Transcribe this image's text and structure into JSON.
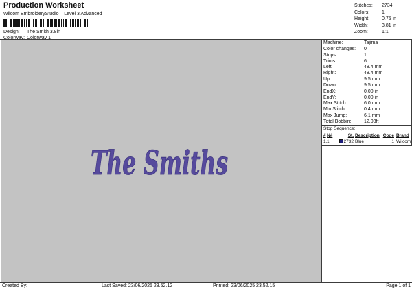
{
  "header": {
    "title": "Production Worksheet",
    "subtitle": "Wilcom EmbroideryStudio – Level 3 Advanced",
    "design_label": "Design:",
    "design_value": "The Smith 3.8in",
    "colorway_label": "Colorway:",
    "colorway_value": "Colorway 1",
    "barcode_icon": "barcode",
    "barcode_pattern": "3121123211213112312112321121311231211232112131123121123211213112312112321"
  },
  "summary": {
    "rows": [
      {
        "label": "Stitches:",
        "value": "2734"
      },
      {
        "label": "Colors:",
        "value": "1"
      },
      {
        "label": "Height:",
        "value": "0.75 in"
      },
      {
        "label": "Width:",
        "value": "3.81 in"
      },
      {
        "label": "Zoom:",
        "value": "1:1"
      }
    ]
  },
  "machine_info": {
    "rows": [
      {
        "label": "Machine:",
        "value": "Tajima"
      },
      {
        "label": "Color changes:",
        "value": "0"
      },
      {
        "label": "Stops:",
        "value": "1"
      },
      {
        "label": "Trims:",
        "value": "6"
      },
      {
        "label": "Left:",
        "value": "48.4 mm"
      },
      {
        "label": "Right:",
        "value": "48.4 mm"
      },
      {
        "label": "Up:",
        "value": "9.5 mm"
      },
      {
        "label": "Down:",
        "value": "9.5 mm"
      },
      {
        "label": "EndX:",
        "value": "0.00 in"
      },
      {
        "label": "EndY:",
        "value": "0.00 in"
      },
      {
        "label": "Max Stitch:",
        "value": "6.0 mm"
      },
      {
        "label": "Min Stitch:",
        "value": "0.4 mm"
      },
      {
        "label": "Max Jump:",
        "value": "6.1 mm"
      },
      {
        "label": "Total Bobbin:",
        "value": "12.03ft"
      }
    ]
  },
  "stop_sequence": {
    "title": "Stop Sequence:",
    "columns": [
      "#",
      "N#",
      "St.",
      "Description",
      "Code",
      "Brand"
    ],
    "rows": [
      {
        "num": "1.",
        "n": "1",
        "swatch_color": "#1c1c7a",
        "st": "2732",
        "description": "Blue",
        "code": "1",
        "brand": "Wilcom"
      }
    ]
  },
  "design_preview": {
    "text": "The Smiths",
    "fill": "#564a9d",
    "outline": "#3a317e",
    "background": "#c3c3c3"
  },
  "footer": {
    "created_by": "Created By:",
    "last_saved": "Last Saved: 23/06/2025 23.52.12",
    "printed": "Printed: 23/06/2025 23.52.15",
    "page": "Page 1 of 1"
  }
}
